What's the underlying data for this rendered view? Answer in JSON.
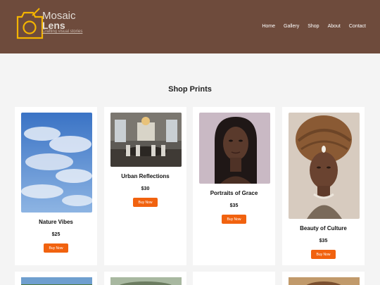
{
  "header": {
    "brand_line1": "Mosaic",
    "brand_line2": "Lens",
    "tagline": "Crafting visual stories",
    "nav": [
      "Home",
      "Gallery",
      "Shop",
      "About",
      "Contact"
    ]
  },
  "page": {
    "title": "Shop Prints"
  },
  "products": [
    {
      "name": "Nature Vibes",
      "price": "$25",
      "button": "Buy Now"
    },
    {
      "name": "Urban Reflections",
      "price": "$30",
      "button": "Buy Now"
    },
    {
      "name": "Portraits of Grace",
      "price": "$35",
      "button": "Buy Now"
    },
    {
      "name": "Beauty of Culture",
      "price": "$35",
      "button": "Buy Now"
    }
  ],
  "colors": {
    "header_bg": "#6e4b3c",
    "accent": "#f1620f",
    "logo_yellow": "#f4b400"
  }
}
